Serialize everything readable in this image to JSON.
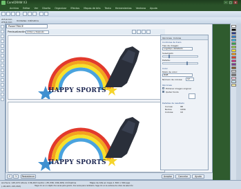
{
  "app": {
    "title": "CorelDRAW X3"
  },
  "menu": [
    "Archivo",
    "Editar",
    "Ver",
    "Diseño",
    "Organizar",
    "Efectos",
    "Mapas de bits",
    "Texto",
    "Herramientas",
    "Ventana",
    "Ayuda"
  ],
  "toolbar2": {
    "size_label": "215,9 mm",
    "size_label2": "279,4 mm",
    "units": "Unidades: milímetros"
  },
  "doc": {
    "tab": "PowerTRACE",
    "view_label": "Previsualización:",
    "view_value": "Antes y después"
  },
  "artwork": {
    "text": "HAPPY SPORTS"
  },
  "panel": {
    "tabs": [
      "Opciones",
      "Colores"
    ],
    "controls_section": "Controles de trazo",
    "type_label": "Tipo de imagen:",
    "type_value": "Logotipo detallado",
    "smoothing_label": "Suavizado:",
    "details_label": "Detalle:",
    "color_section": "Color",
    "mode_label": "Modo de color:",
    "mode_value": "RGB",
    "colors_label": "Número de colores:",
    "colors_value": "12",
    "options_section": "Opciones",
    "opt1": "Eliminar imagen original",
    "opt2": "Quitar fondo",
    "result_section": "Detalles de resultado",
    "curves_label": "Curvas:",
    "curves_value": "98",
    "nodes_label": "Nodos:",
    "nodes_value": "1934",
    "colors2_label": "Colores:",
    "colors2_value": "10"
  },
  "bottom": {
    "reset": "Restablecer",
    "ok": "Aceptar",
    "cancel": "Cancelar",
    "help": "Ayuda"
  },
  "status": {
    "line1": "Anchura: 145,472 Altura: 136,293 Centro: (35,336; 184,295) milímetros",
    "line2": "Mapa de bits en Capa 1 300 x 300 ppp",
    "line3": "(-18,403; 215,393)",
    "line4": "Haga clic en un objeto dos veces para girarlo; dos veces para cambiarlo; haga clic en la ventana de orden de selección"
  },
  "colors": {
    "accent": "#2a5229",
    "panel_section": "#2a4e87",
    "text_dark": "#1b2550"
  }
}
